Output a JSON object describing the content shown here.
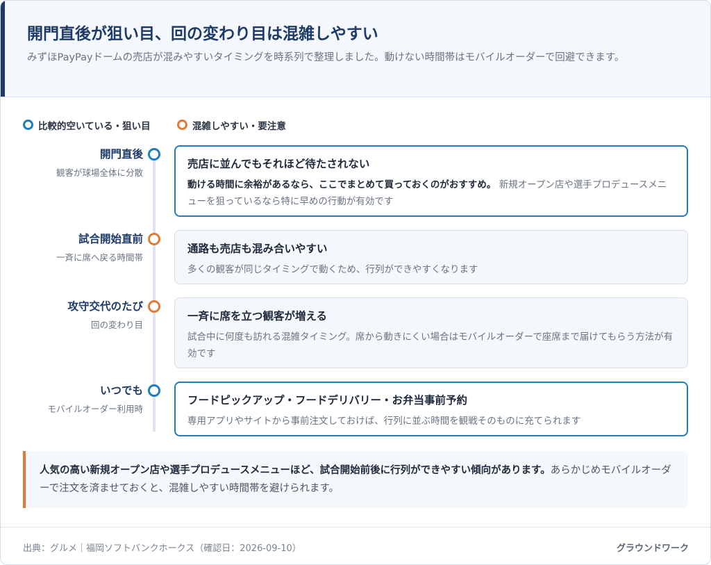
{
  "header": {
    "title": "開門直後が狙い目、回の変わり目は混雑しやすい",
    "subtitle": "みずほPayPayドームの売店が混みやすいタイミングを時系列で整理しました。動けない時間帯はモバイルオーダーで回避できます。"
  },
  "legend": [
    {
      "label": "比較的空いている・狙い目",
      "color": "#1e7cbf"
    },
    {
      "label": "混雑しやすい・要注意",
      "color": "#e07b35"
    }
  ],
  "timeline": [
    {
      "label": "開門直後",
      "sublabel": "観客が球場全体に分散",
      "status": "good",
      "title": "売店に並んでもそれほど待たされない",
      "body_strong": "動ける時間に余裕があるなら、ここでまとめて買っておくのがおすすめ。",
      "body": "新規オープン店や選手プロデュースメニューを狙っているなら特に早めの行動が有効です"
    },
    {
      "label": "試合開始直前",
      "sublabel": "一斉に席へ戻る時間帯",
      "status": "busy",
      "title": "通路も売店も混み合いやすい",
      "body_strong": "",
      "body": "多くの観客が同じタイミングで動くため、行列ができやすくなります"
    },
    {
      "label": "攻守交代のたび",
      "sublabel": "回の変わり目",
      "status": "busy",
      "title": "一斉に席を立つ観客が増える",
      "body_strong": "",
      "body": "試合中に何度も訪れる混雑タイミング。席から動きにくい場合はモバイルオーダーで座席まで届けてもらう方法が有効です"
    },
    {
      "label": "いつでも",
      "sublabel": "モバイルオーダー利用時",
      "status": "good",
      "title": "フードピックアップ・フードデリバリー・お弁当事前予約",
      "body_strong": "",
      "body": "専用アプリやサイトから事前注文しておけば、行列に並ぶ時間を観戦そのものに充てられます"
    }
  ],
  "note": {
    "strong": "人気の高い新規オープン店や選手プロデュースメニューほど、試合開始前後に行列ができやすい傾向があります。",
    "text": "あらかじめモバイルオーダーで注文を済ませておくと、混雑しやすい時間帯を避けられます。"
  },
  "footer": {
    "source": "出典：グルメ｜福岡ソフトバンクホークス（確認日：2026-09-10）",
    "brand": "グラウンドワーク"
  }
}
